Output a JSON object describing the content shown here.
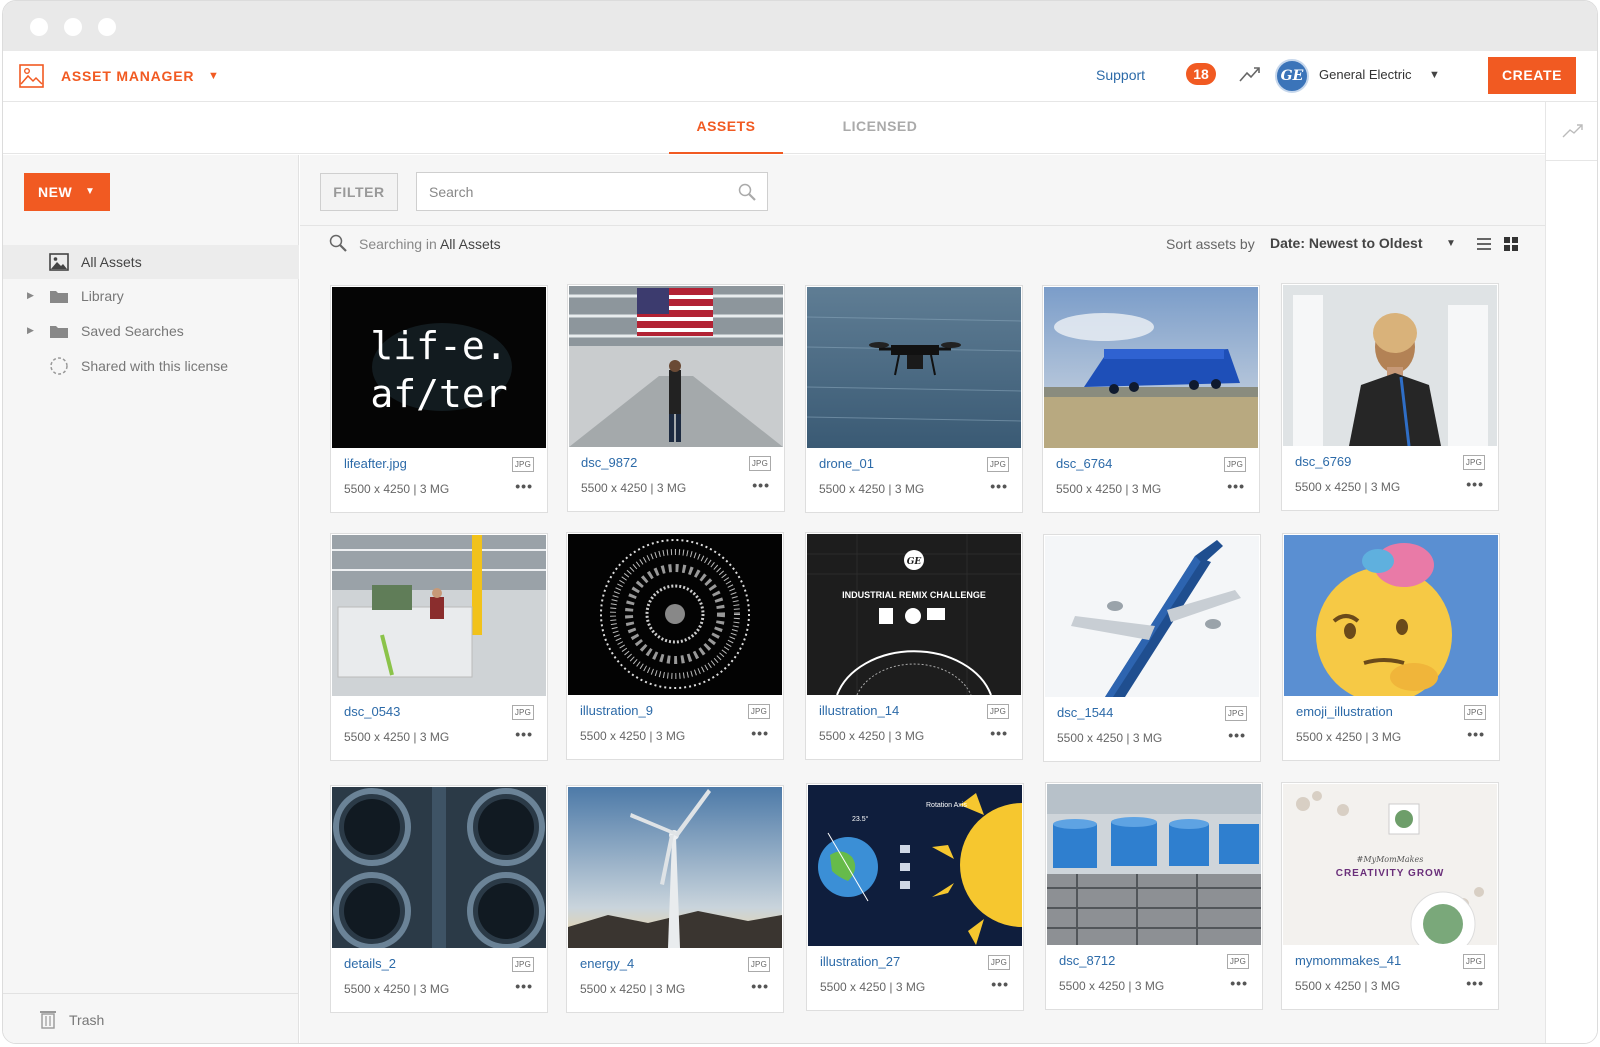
{
  "app": {
    "title": "ASSET MANAGER",
    "support_label": "Support",
    "notification_count": "18",
    "company_name": "General Electric",
    "company_logo_text": "GE",
    "create_label": "CREATE"
  },
  "tabs": [
    {
      "label": "ASSETS",
      "active": true
    },
    {
      "label": "LICENSED",
      "active": false
    }
  ],
  "sidebar": {
    "new_label": "NEW",
    "items": [
      {
        "label": "All Assets",
        "icon": "image-icon",
        "active": true,
        "expandable": false
      },
      {
        "label": "Library",
        "icon": "folder-icon",
        "active": false,
        "expandable": true
      },
      {
        "label": "Saved Searches",
        "icon": "folder-icon",
        "active": false,
        "expandable": true
      },
      {
        "label": "Shared with this license",
        "icon": "dashed-circle-icon",
        "active": false,
        "expandable": false
      }
    ],
    "trash_label": "Trash"
  },
  "toolbar": {
    "filter_label": "FILTER",
    "search_placeholder": "Search",
    "search_value": "",
    "searching_prefix": "Searching in",
    "searching_scope": "All Assets",
    "sort_label": "Sort assets by",
    "sort_value": "Date: Newest to Oldest"
  },
  "assets": [
    {
      "name": "lifeafter.jpg",
      "type": "JPG",
      "dims": "5500 x 4250 | 3 MG"
    },
    {
      "name": "dsc_9872",
      "type": "JPG",
      "dims": "5500 x 4250 | 3 MG"
    },
    {
      "name": "drone_01",
      "type": "JPG",
      "dims": "5500 x 4250 | 3 MG"
    },
    {
      "name": "dsc_6764",
      "type": "JPG",
      "dims": "5500 x 4250 | 3 MG"
    },
    {
      "name": "dsc_6769",
      "type": "JPG",
      "dims": "5500 x 4250 | 3 MG"
    },
    {
      "name": "dsc_0543",
      "type": "JPG",
      "dims": "5500 x 4250 | 3 MG"
    },
    {
      "name": "illustration_9",
      "type": "JPG",
      "dims": "5500 x 4250 | 3 MG"
    },
    {
      "name": "illustration_14",
      "type": "JPG",
      "dims": "5500 x 4250 | 3 MG"
    },
    {
      "name": "dsc_1544",
      "type": "JPG",
      "dims": "5500 x 4250 | 3 MG"
    },
    {
      "name": "emoji_illustration",
      "type": "JPG",
      "dims": "5500 x 4250 | 3 MG"
    },
    {
      "name": "details_2",
      "type": "JPG",
      "dims": "5500 x 4250 | 3 MG"
    },
    {
      "name": "energy_4",
      "type": "JPG",
      "dims": "5500 x 4250 | 3 MG"
    },
    {
      "name": "illustration_27",
      "type": "JPG",
      "dims": "5500 x 4250 | 3 MG"
    },
    {
      "name": "dsc_8712",
      "type": "JPG",
      "dims": "5500 x 4250 | 3 MG"
    },
    {
      "name": "mymommakes_41",
      "type": "JPG",
      "dims": "5500 x 4250 | 3 MG"
    }
  ],
  "thumbnail_text": {
    "lifeafter_line1": "lif-e.",
    "lifeafter_line2": "af/ter",
    "remix_title": "INDUSTRIAL REMIX CHALLENGE",
    "rotation_axis": "Rotation Axis",
    "tilt": "23.5°",
    "creativity_tag": "#MyMomMakes",
    "creativity_title": "CREATIVITY GROW"
  },
  "colors": {
    "accent": "#f15a22",
    "link": "#2c6aa8",
    "sidebar_bg": "#f6f6f6"
  }
}
